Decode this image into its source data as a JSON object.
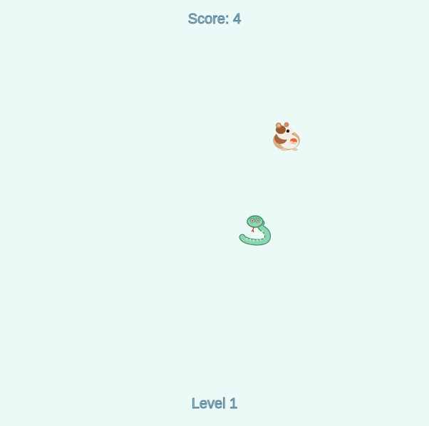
{
  "hud": {
    "score_text": "Score: 4",
    "level_text": "Level 1"
  },
  "sprites": {
    "food": "hamster-sprite",
    "player": "snake-sprite"
  },
  "colors": {
    "background": "#ebf9f7",
    "hud_fill": "#9cc3cf",
    "hud_outline": "#4d7c92",
    "snake_body": "#8fd4b0",
    "snake_outline": "#3f8f6b"
  }
}
